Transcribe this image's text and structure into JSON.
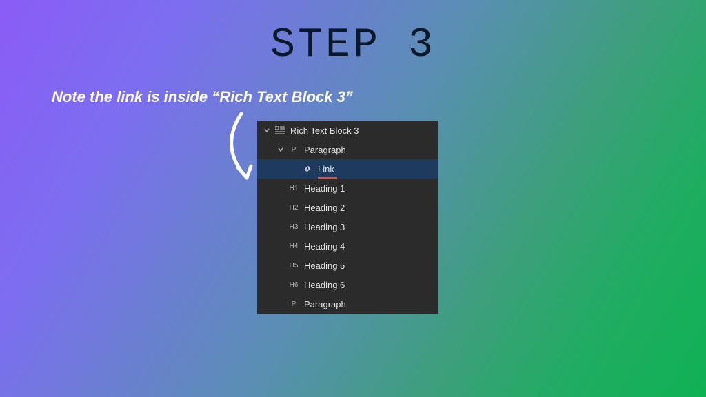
{
  "slide": {
    "title": "STEP 3",
    "annotation": "Note the link is inside “Rich Text Block 3”"
  },
  "tree": {
    "root": {
      "icon": "rich-text-block",
      "label": "Rich Text Block 3",
      "expanded": true
    },
    "items": [
      {
        "icon": "P",
        "label": "Paragraph",
        "expanded": true,
        "indent": 1,
        "hasChevron": true
      },
      {
        "icon": "link",
        "label": "Link",
        "indent": 2,
        "selected": true,
        "underlined": true
      },
      {
        "icon": "H1",
        "label": "Heading 1",
        "indent": 1
      },
      {
        "icon": "H2",
        "label": "Heading 2",
        "indent": 1
      },
      {
        "icon": "H3",
        "label": "Heading 3",
        "indent": 1
      },
      {
        "icon": "H4",
        "label": "Heading 4",
        "indent": 1
      },
      {
        "icon": "H5",
        "label": "Heading 5",
        "indent": 1
      },
      {
        "icon": "H6",
        "label": "Heading 6",
        "indent": 1
      },
      {
        "icon": "P",
        "label": "Paragraph",
        "indent": 1
      }
    ]
  },
  "colors": {
    "accent_underline": "#e74c3c",
    "selected_row": "#1e3a5f",
    "panel_bg": "#2b2b2b"
  }
}
